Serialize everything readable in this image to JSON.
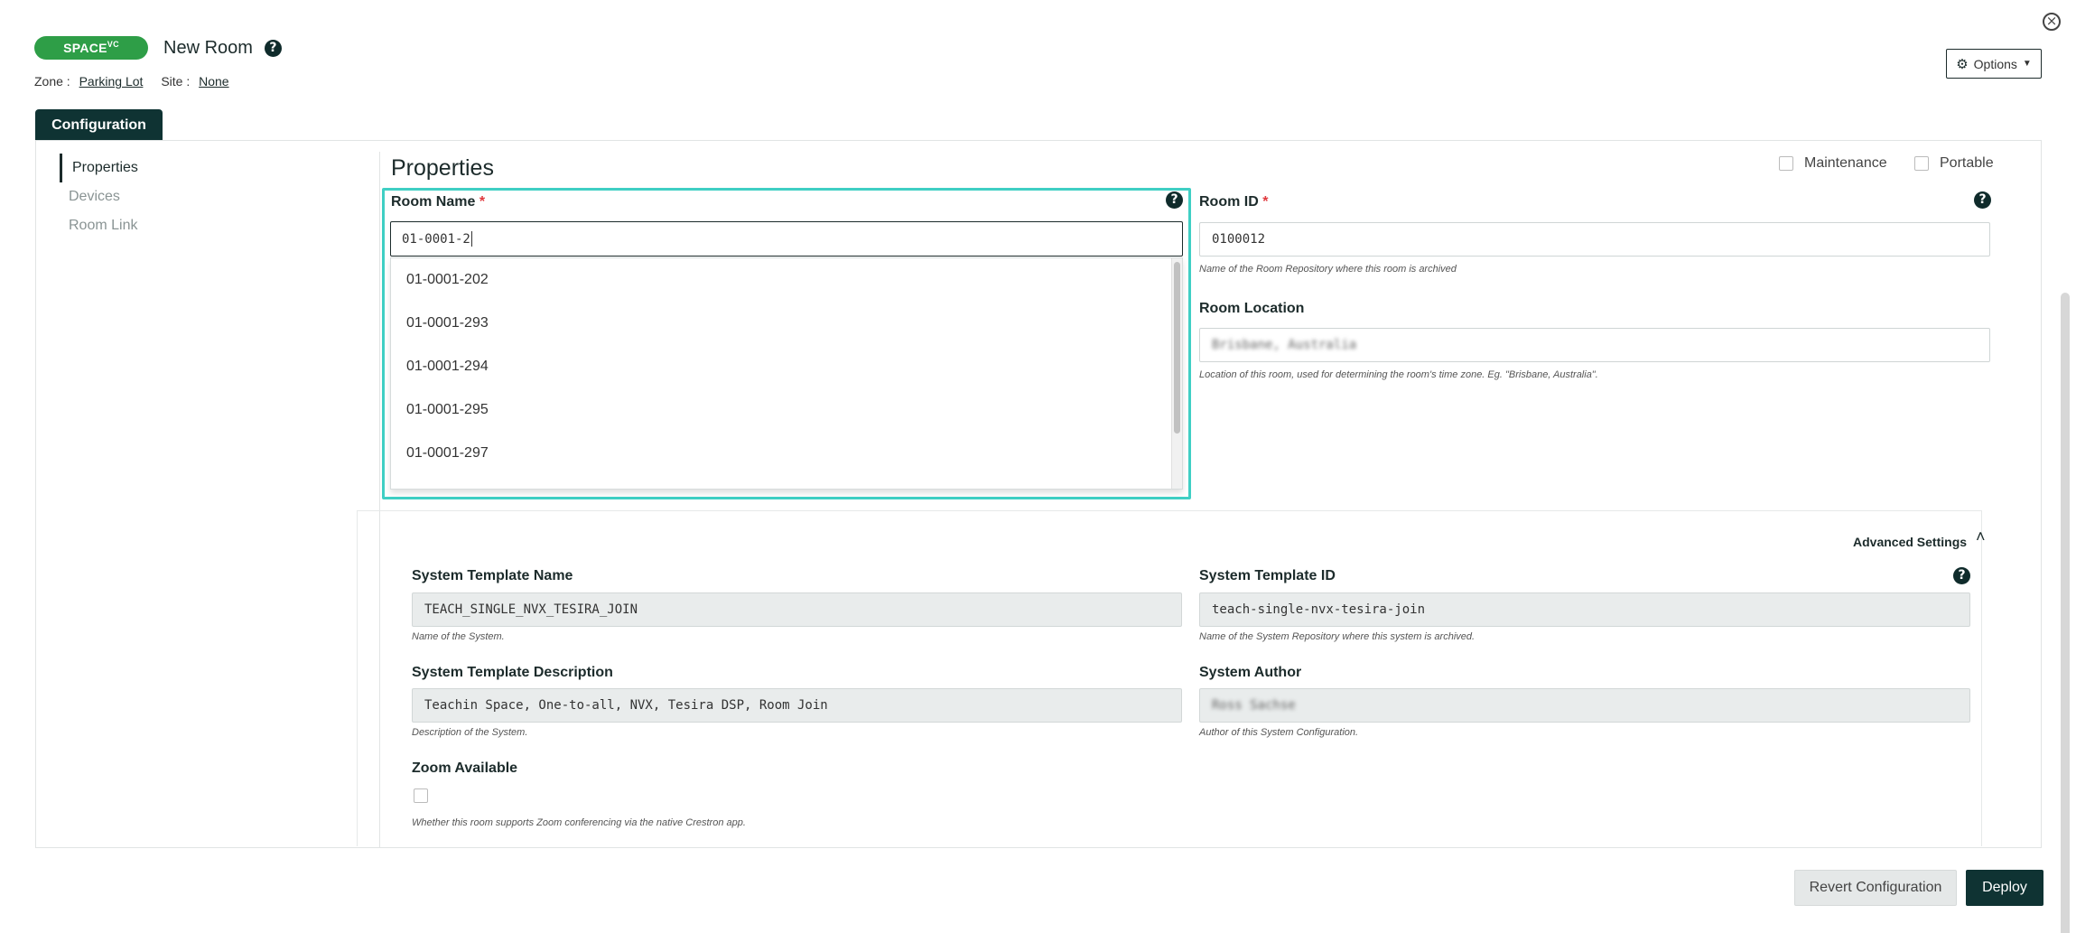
{
  "header": {
    "logo_text": "SPACE",
    "logo_sup": "VC",
    "title": "New Room",
    "zone_label": "Zone :",
    "zone_value": "Parking Lot",
    "site_label": "Site :",
    "site_value": "None",
    "options_label": "Options"
  },
  "tabs": {
    "configuration": "Configuration"
  },
  "sidebar": {
    "items": [
      {
        "label": "Properties"
      },
      {
        "label": "Devices"
      },
      {
        "label": "Room Link"
      }
    ]
  },
  "properties": {
    "title": "Properties",
    "maintenance_label": "Maintenance",
    "portable_label": "Portable",
    "room_name": {
      "label": "Room Name",
      "required_mark": "*",
      "value": "01-0001-2",
      "suggestions": [
        "01-0001-202",
        "01-0001-293",
        "01-0001-294",
        "01-0001-295",
        "01-0001-297"
      ]
    },
    "room_id": {
      "label": "Room ID",
      "required_mark": "*",
      "value": "0100012",
      "hint": "Name of the Room Repository where this room is archived"
    },
    "room_location": {
      "label": "Room Location",
      "value": "Brisbane, Australia",
      "hint": "Location of this room, used for determining the room's time zone. Eg. \"Brisbane, Australia\"."
    }
  },
  "advanced": {
    "title": "Advanced Settings",
    "system_template_name": {
      "label": "System Template Name",
      "value": "TEACH_SINGLE_NVX_TESIRA_JOIN",
      "hint": "Name of the System."
    },
    "system_template_id": {
      "label": "System Template ID",
      "value": "teach-single-nvx-tesira-join",
      "hint": "Name of the System Repository where this system is archived."
    },
    "system_template_description": {
      "label": "System Template Description",
      "value": "Teachin Space, One-to-all, NVX, Tesira DSP, Room Join",
      "hint": "Description of the System."
    },
    "system_author": {
      "label": "System Author",
      "value": "Ross Sachse",
      "hint": "Author of this System Configuration."
    },
    "zoom": {
      "label": "Zoom Available",
      "hint": "Whether this room supports Zoom conferencing via the native Crestron app."
    }
  },
  "footer": {
    "revert_label": "Revert Configuration",
    "deploy_label": "Deploy"
  },
  "colors": {
    "brand_green": "#2e9e47",
    "dark_teal": "#0f3333",
    "focus_cyan": "#3fcfc4",
    "required_red": "#e0393e"
  }
}
